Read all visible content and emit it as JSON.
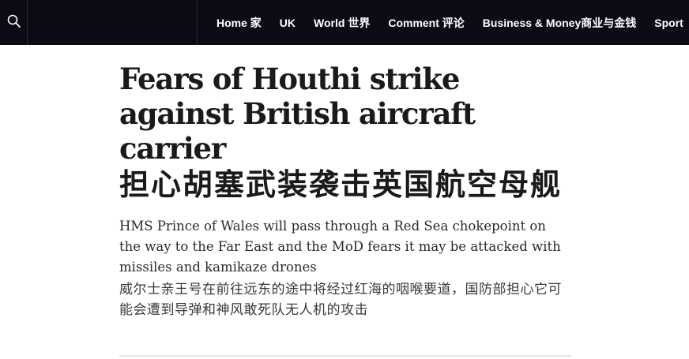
{
  "nav": {
    "masthead": "",
    "items": [
      {
        "label": "Home 家"
      },
      {
        "label": "UK"
      },
      {
        "label": "World 世界"
      },
      {
        "label": "Comment 评论"
      },
      {
        "label": "Business & Money商业与金钱"
      },
      {
        "label": "Sport"
      }
    ],
    "icons": {
      "search": "search-icon"
    }
  },
  "article": {
    "headline_en": "Fears of Houthi strike against British aircraft carrier",
    "headline_zh": "担心胡塞武装袭击英国航空母舰",
    "standfirst_en": "HMS Prince of Wales will pass through a Red Sea chokepoint on the way to the Far East and the MoD fears it may be attacked with missiles and kamikaze drones",
    "standfirst_zh": "威尔士亲王号在前往远东的途中将经过红海的咽喉要道，国防部担心它可能会遭到导弹和神风敢死队无人机的攻击"
  },
  "colors": {
    "topbar_bg": "#0b0b16",
    "nav_text": "#ffffff",
    "headline_text": "#1a1a1a"
  }
}
